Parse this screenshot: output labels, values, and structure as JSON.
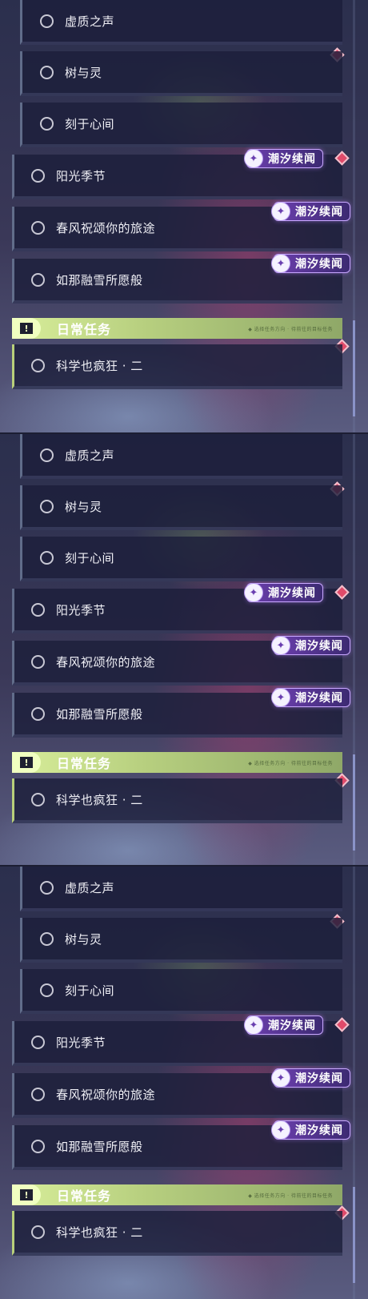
{
  "frames": [
    {
      "quests": [
        {
          "label": "虚质之声"
        },
        {
          "label": "树与灵"
        },
        {
          "label": "刻于心间"
        },
        {
          "label": "阳光季节",
          "tag": "潮汐续闻"
        },
        {
          "label": "春风祝颂你的旅途",
          "tag": "潮汐续闻"
        },
        {
          "label": "如那融雪所愿般",
          "tag": "潮汐续闻"
        }
      ],
      "daily_section": {
        "icon": "!",
        "title": "日常任务",
        "note": "◆ 选择任务方向 · 待前往的目标任务"
      },
      "daily_quests": [
        {
          "label": "科学也疯狂 · 二"
        }
      ]
    },
    {
      "quests": [
        {
          "label": "虚质之声"
        },
        {
          "label": "树与灵"
        },
        {
          "label": "刻于心间"
        },
        {
          "label": "阳光季节",
          "tag": "潮汐续闻"
        },
        {
          "label": "春风祝颂你的旅途",
          "tag": "潮汐续闻"
        },
        {
          "label": "如那融雪所愿般",
          "tag": "潮汐续闻"
        }
      ],
      "daily_section": {
        "icon": "!",
        "title": "日常任务",
        "note": "◆ 选择任务方向 · 待前往的目标任务"
      },
      "daily_quests": [
        {
          "label": "科学也疯狂 · 二"
        }
      ]
    },
    {
      "quests": [
        {
          "label": "虚质之声"
        },
        {
          "label": "树与灵"
        },
        {
          "label": "刻于心间"
        },
        {
          "label": "阳光季节",
          "tag": "潮汐续闻"
        },
        {
          "label": "春风祝颂你的旅途",
          "tag": "潮汐续闻"
        },
        {
          "label": "如那融雪所愿般",
          "tag": "潮汐续闻"
        }
      ],
      "daily_section": {
        "icon": "!",
        "title": "日常任务",
        "note": "◆ 选择任务方向 · 待前往的目标任务"
      },
      "daily_quests": [
        {
          "label": "科学也疯狂 · 二"
        }
      ]
    }
  ],
  "colors": {
    "accent_daily": "#b8d07a",
    "tag_purple": "#6c3fae",
    "marker_red": "#e04a6a"
  },
  "icons": {
    "quest_status": "circle-outline-icon",
    "tag_logo": "tidal-chronicle-icon",
    "marker": "red-diamond-icon",
    "daily_header": "exclamation-icon"
  }
}
